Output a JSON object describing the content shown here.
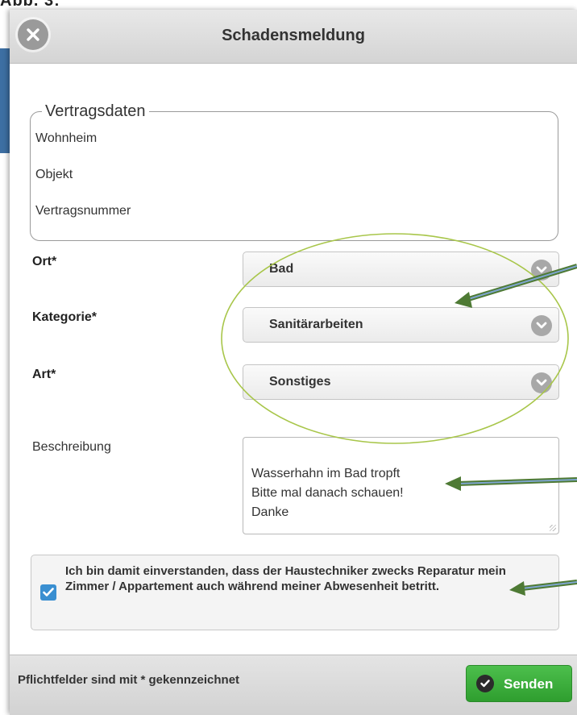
{
  "caption": "Abb. 3:",
  "dialog": {
    "title": "Schadensmeldung",
    "close_icon": "close-circle-icon"
  },
  "contract": {
    "legend": "Vertragsdaten",
    "rows": [
      "Wohnheim",
      "Objekt",
      "Vertragsnummer"
    ]
  },
  "fields": {
    "ort": {
      "label": "Ort*",
      "value": "Bad"
    },
    "kategorie": {
      "label": "Kategorie*",
      "value": "Sanitärarbeiten"
    },
    "art": {
      "label": "Art*",
      "value": "Sonstiges"
    },
    "beschreibung": {
      "label": "Beschreibung",
      "value": "Wasserhahn im Bad tropft\nBitte mal danach schauen!\nDanke"
    }
  },
  "consent": {
    "checked": true,
    "text": "Ich bin damit einverstanden, dass der Haustechniker zwecks Reparatur mein Zimmer / Appartement auch während meiner Abwesenheit betritt."
  },
  "footer": {
    "note": "Pflichtfelder sind mit * gekennzeichnet",
    "send_label": "Senden",
    "send_icon": "check-icon"
  },
  "colors": {
    "annotation_ellipse": "#a8c64a",
    "annotation_arrow": "#5a8a3c",
    "send_button": "#3aae3a",
    "checkbox": "#3a8fd1"
  }
}
